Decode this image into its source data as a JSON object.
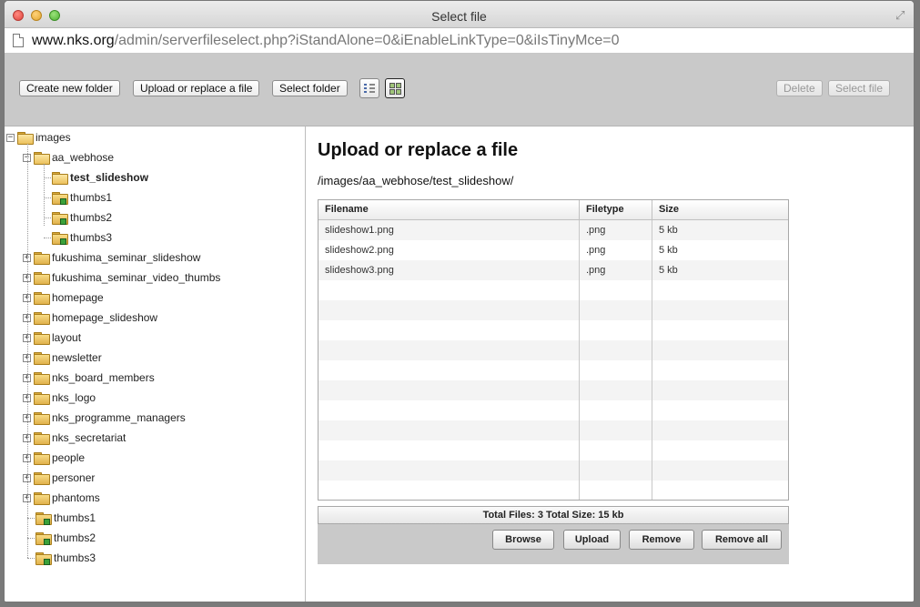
{
  "window": {
    "title": "Select file"
  },
  "url": {
    "host": "www.nks.org",
    "path": "/admin/serverfileselect.php?iStandAlone=0&iEnableLinkType=0&iIsTinyMce=0"
  },
  "toolbar": {
    "create_folder": "Create new folder",
    "upload_replace": "Upload or replace a file",
    "select_folder": "Select folder",
    "delete": "Delete",
    "select_file": "Select file",
    "active_view": "thumbnails"
  },
  "tree": {
    "root": "images",
    "aa_webhose": "aa_webhose",
    "aa_children": [
      "test_slideshow",
      "thumbs1",
      "thumbs2",
      "thumbs3"
    ],
    "folders": [
      "fukushima_seminar_slideshow",
      "fukushima_seminar_video_thumbs",
      "homepage",
      "homepage_slideshow",
      "layout",
      "newsletter",
      "nks_board_members",
      "nks_logo",
      "nks_programme_managers",
      "nks_secretariat",
      "people",
      "personer",
      "phantoms"
    ],
    "root_thumbs": [
      "thumbs1",
      "thumbs2",
      "thumbs3"
    ],
    "selected": "test_slideshow"
  },
  "main": {
    "heading": "Upload or replace a file",
    "path": "/images/aa_webhose/test_slideshow/",
    "columns": [
      "Filename",
      "Filetype",
      "Size"
    ],
    "files": [
      {
        "name": "slideshow1.png",
        "type": ".png",
        "size": "5 kb"
      },
      {
        "name": "slideshow2.png",
        "type": ".png",
        "size": "5 kb"
      },
      {
        "name": "slideshow3.png",
        "type": ".png",
        "size": "5 kb"
      }
    ],
    "totals": "Total Files: 3 Total Size: 15 kb",
    "buttons": {
      "browse": "Browse",
      "upload": "Upload",
      "remove": "Remove",
      "remove_all": "Remove all"
    }
  }
}
